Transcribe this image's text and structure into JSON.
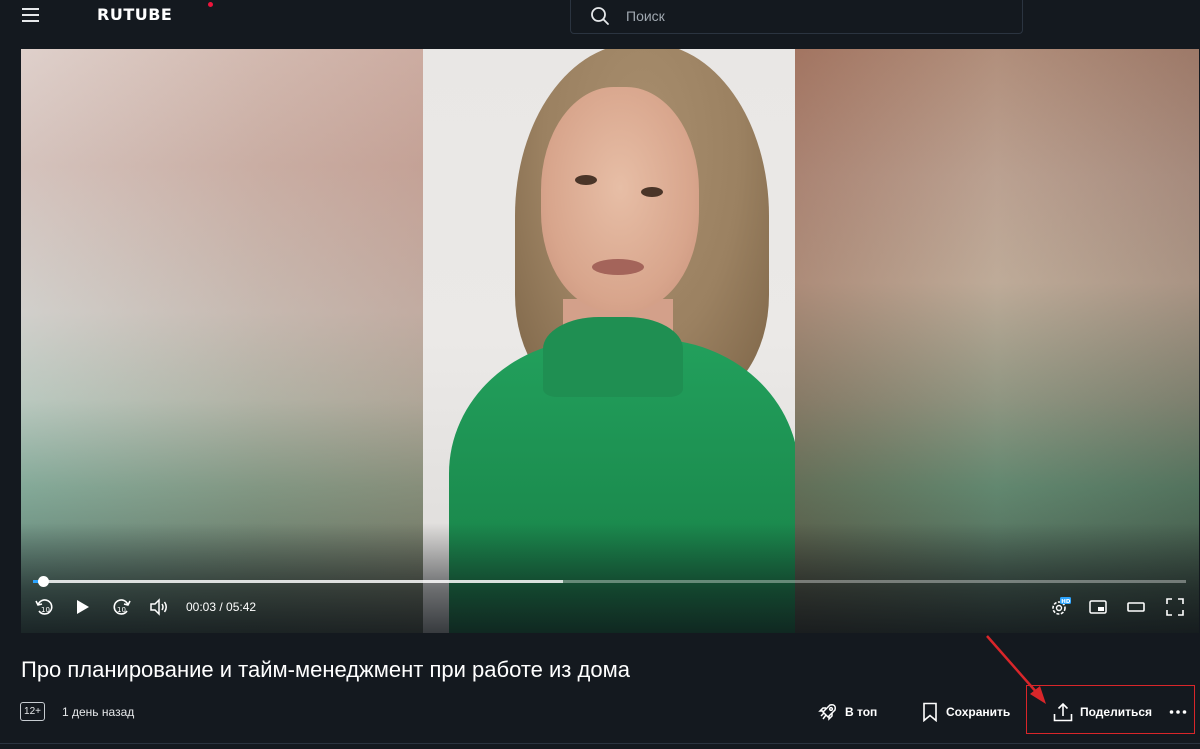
{
  "header": {
    "logo": "RUTUBE",
    "search": {
      "placeholder": "Поиск"
    }
  },
  "player": {
    "time": "00:03 / 05:42",
    "progress_fraction": 0.0083,
    "buffered_fraction": 0.46,
    "accent_color": "#2ca4ff",
    "quality_badge": "HD",
    "controls": [
      "rewind-10-icon",
      "play-icon",
      "forward-10-icon",
      "volume-icon",
      "settings-icon",
      "mini-player-icon",
      "theater-mode-icon",
      "fullscreen-icon"
    ]
  },
  "video": {
    "title": "Про планирование и тайм-менеджмент при работе из дома",
    "age_rating": "12+",
    "published": "1 день назад"
  },
  "actions": {
    "top_label": "В топ",
    "save_label": "Сохранить",
    "share_label": "Поделиться"
  },
  "annotation": {
    "highlight_color": "#d9262a"
  }
}
